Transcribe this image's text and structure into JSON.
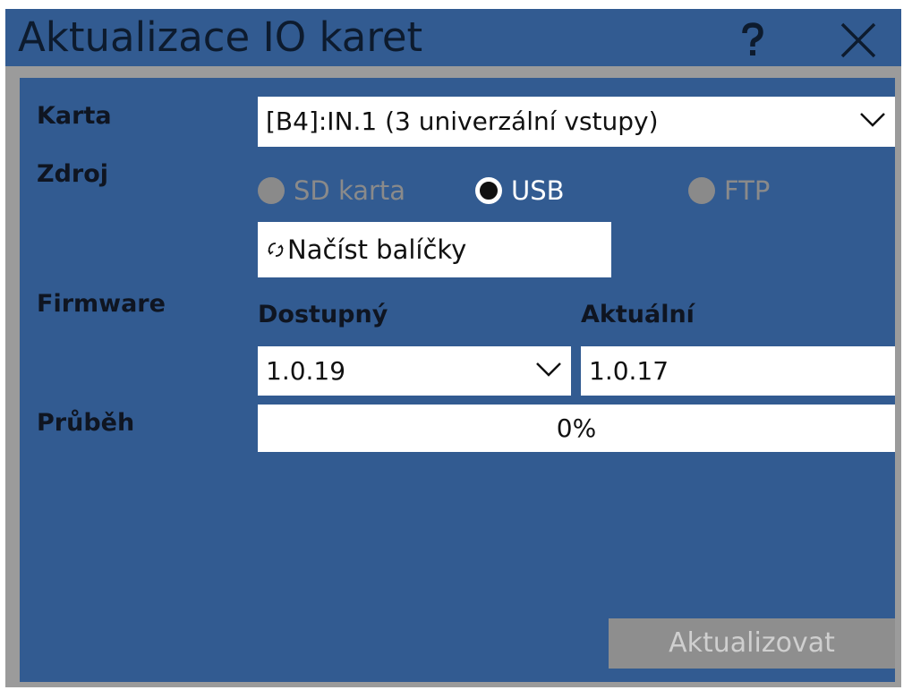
{
  "window": {
    "title": "Aktualizace IO karet",
    "help_label": "?",
    "background_color": "#325b91",
    "frame_color": "#9b9b9b"
  },
  "card": {
    "label": "Karta",
    "selected": "[B4]:IN.1 (3 univerzální vstupy)"
  },
  "source": {
    "label": "Zdroj",
    "options": [
      {
        "label": "SD karta",
        "checked": false,
        "enabled": false
      },
      {
        "label": "USB",
        "checked": true,
        "enabled": true
      },
      {
        "label": "FTP",
        "checked": false,
        "enabled": false
      }
    ]
  },
  "load_packages": {
    "label": "Načíst balíčky",
    "icon": "refresh-icon"
  },
  "firmware": {
    "label": "Firmware",
    "available_header": "Dostupný",
    "current_header": "Aktuální",
    "available_value": "1.0.19",
    "current_value": "1.0.17"
  },
  "progress": {
    "label": "Průběh",
    "text": "0%",
    "percent": 0
  },
  "update_button": {
    "label": "Aktualizovat",
    "enabled": false
  }
}
